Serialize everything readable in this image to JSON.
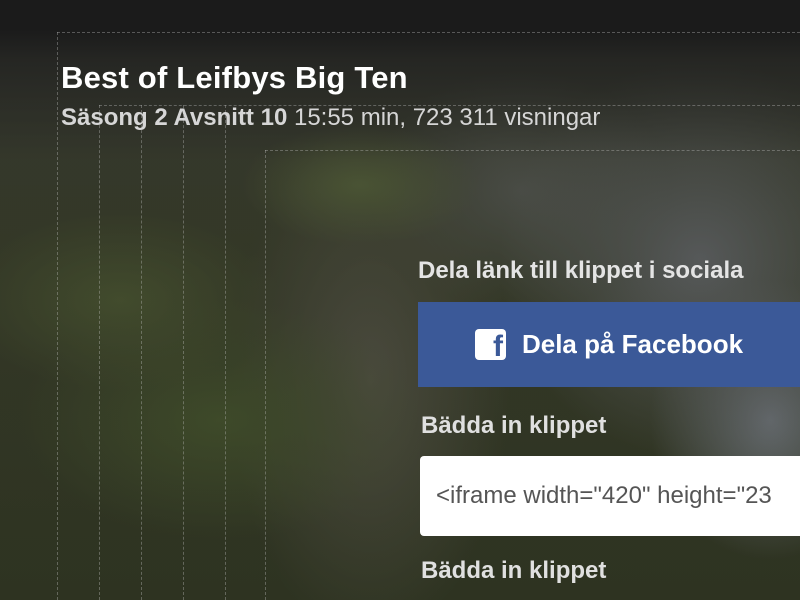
{
  "video": {
    "title": "Best of Leifbys Big Ten",
    "episode": "Säsong 2 Avsnitt 10",
    "details": "15:55 min, 723 311 visningar"
  },
  "share": {
    "heading": "Dela länk till klippet i sociala",
    "facebook_label": "Dela på Facebook",
    "facebook_icon": "f",
    "facebook_color": "#3b5998"
  },
  "embed": {
    "heading_1": "Bädda in klippet",
    "code": "<iframe width=\"420\" height=\"23",
    "heading_2": "Bädda in klippet"
  }
}
